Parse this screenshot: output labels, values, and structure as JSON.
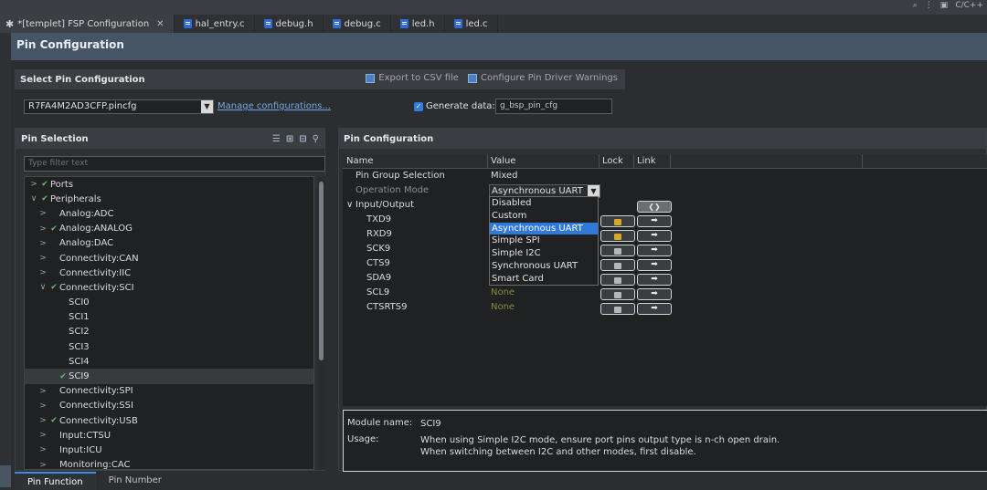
{
  "topbar": {
    "perspective_label": "C/C++"
  },
  "tabs": [
    {
      "label": "*[templet] FSP Configuration",
      "close": "✕",
      "icon": "gear-icon"
    },
    {
      "label": "hal_entry.c",
      "icon": "c-file-icon"
    },
    {
      "label": "debug.h",
      "icon": "h-file-icon"
    },
    {
      "label": "debug.c",
      "icon": "c-file-icon"
    },
    {
      "label": "led.h",
      "icon": "h-file-icon"
    },
    {
      "label": "led.c",
      "icon": "c-file-icon"
    }
  ],
  "page": {
    "title": "Pin Configuration"
  },
  "select_pin_config": {
    "title": "Select Pin Configuration",
    "export_label": "Export to CSV file",
    "warnings_label": "Configure Pin Driver Warnings",
    "config_file": "R7FA4M2AD3CFP.pincfg",
    "manage_link": "Manage configurations...",
    "generate_label": "Generate data:",
    "generate_value": "g_bsp_pin_cfg",
    "generate_checked": true
  },
  "pin_selection": {
    "title": "Pin Selection",
    "filter_placeholder": "Type filter text",
    "tree": [
      {
        "label": "Ports",
        "arrow": ">",
        "check": true,
        "level": 0
      },
      {
        "label": "Peripherals",
        "arrow": "∨",
        "check": true,
        "level": 0
      },
      {
        "label": "Analog:ADC",
        "arrow": ">",
        "check": false,
        "level": 1
      },
      {
        "label": "Analog:ANALOG",
        "arrow": ">",
        "check": true,
        "level": 1
      },
      {
        "label": "Analog:DAC",
        "arrow": ">",
        "check": false,
        "level": 1
      },
      {
        "label": "Connectivity:CAN",
        "arrow": ">",
        "check": false,
        "level": 1
      },
      {
        "label": "Connectivity:IIC",
        "arrow": ">",
        "check": false,
        "level": 1
      },
      {
        "label": "Connectivity:SCI",
        "arrow": "∨",
        "check": true,
        "level": 1
      },
      {
        "label": "SCI0",
        "arrow": "",
        "check": false,
        "level": 2
      },
      {
        "label": "SCI1",
        "arrow": "",
        "check": false,
        "level": 2
      },
      {
        "label": "SCI2",
        "arrow": "",
        "check": false,
        "level": 2
      },
      {
        "label": "SCI3",
        "arrow": "",
        "check": false,
        "level": 2
      },
      {
        "label": "SCI4",
        "arrow": "",
        "check": false,
        "level": 2
      },
      {
        "label": "SCI9",
        "arrow": "",
        "check": true,
        "level": 2,
        "selected": true
      },
      {
        "label": "Connectivity:SPI",
        "arrow": ">",
        "check": false,
        "level": 1
      },
      {
        "label": "Connectivity:SSI",
        "arrow": ">",
        "check": false,
        "level": 1
      },
      {
        "label": "Connectivity:USB",
        "arrow": ">",
        "check": true,
        "level": 1
      },
      {
        "label": "Input:CTSU",
        "arrow": ">",
        "check": false,
        "level": 1
      },
      {
        "label": "Input:ICU",
        "arrow": ">",
        "check": false,
        "level": 1
      },
      {
        "label": "Monitoring:CAC",
        "arrow": ">",
        "check": false,
        "level": 1
      }
    ]
  },
  "pin_config": {
    "title": "Pin Configuration",
    "columns": [
      "Name",
      "Value",
      "Lock",
      "Link"
    ],
    "rows": [
      {
        "name": "Pin Group Selection",
        "value": "Mixed"
      },
      {
        "name": "Operation Mode",
        "value": "Asynchronous UART"
      },
      {
        "name": "Input/Output",
        "value": ""
      },
      {
        "name": "TXD9",
        "value": ""
      },
      {
        "name": "RXD9",
        "value": ""
      },
      {
        "name": "SCK9",
        "value": ""
      },
      {
        "name": "CTS9",
        "value": ""
      },
      {
        "name": "SDA9",
        "value": ""
      },
      {
        "name": "SCL9",
        "value": "None"
      },
      {
        "name": "CTSRTS9",
        "value": "None"
      }
    ],
    "dropdown_options": [
      "Disabled",
      "Custom",
      "Asynchronous UART",
      "Simple SPI",
      "Simple I2C",
      "Synchronous UART",
      "Smart Card"
    ],
    "dropdown_selected": "Asynchronous UART",
    "link_arrow": "➡",
    "nav_arrows": "❮❯",
    "module_name_label": "Module name:",
    "module_name": "SCI9",
    "usage_label": "Usage:",
    "usage_line1": "When using Simple I2C mode, ensure port pins output type is n-ch open drain.",
    "usage_line2": "When switching between I2C and other modes, first disable."
  },
  "bottom_tabs": [
    "Pin Function",
    "Pin Number"
  ]
}
